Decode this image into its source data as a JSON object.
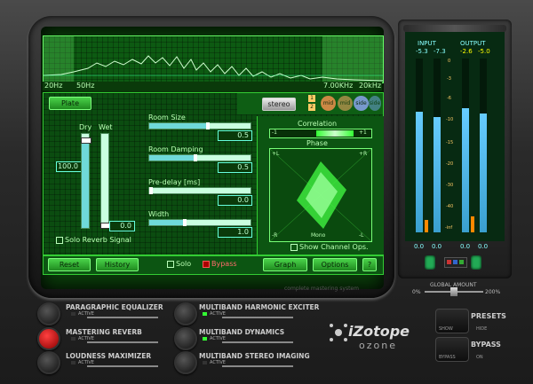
{
  "eq": {
    "f20": "20Hz",
    "f50": "50Hz",
    "f7k": "7.00KHz",
    "f20k": "20kHz"
  },
  "reverb": {
    "preset_btn": "Plate",
    "stereo_btn": "stereo",
    "band_btns": [
      "1",
      "2",
      "3",
      "4"
    ],
    "band_circles": [
      "mid",
      "mid",
      "side",
      "side"
    ],
    "dry_label": "Dry",
    "wet_label": "Wet",
    "dry_value": "100.0",
    "wet_value": "0.0",
    "solo_reverb": "Solo Reverb Signal",
    "params": [
      {
        "label": "Room Size",
        "value": "0.5"
      },
      {
        "label": "Room Damping",
        "value": "0.5"
      },
      {
        "label": "Pre-delay [ms]",
        "value": "0.0"
      },
      {
        "label": "Width",
        "value": "1.0"
      }
    ],
    "correlation": "Correlation",
    "corr_minus": "-1",
    "corr_plus": "+1",
    "phase": "Phase",
    "phase_pl": "+L",
    "phase_pr": "+R",
    "phase_ml": "-R",
    "phase_mono": "Mono",
    "phase_mr": "-L",
    "show_channel_ops": "Show Channel Ops."
  },
  "bottom_bar": {
    "reset": "Reset",
    "history": "History",
    "solo": "Solo",
    "bypass": "Bypass",
    "graph": "Graph",
    "options": "Options",
    "help": "?"
  },
  "caption": "complete mastering system",
  "meter": {
    "input": "INPUT",
    "output": "OUTPUT",
    "in_l": "-5.3",
    "in_r": "-7.3",
    "out_l": "-2.6",
    "out_r": "-5.0",
    "scale": [
      "0",
      "-3",
      "-6",
      "-10",
      "-15",
      "-20",
      "-30",
      "-40",
      "-inf"
    ],
    "bottom_vals": [
      "0.0",
      "0.0",
      "0.0",
      "0.0"
    ],
    "global_amount": "GLOBAL AMOUNT",
    "ga_min": "0%",
    "ga_max": "200%"
  },
  "modules": [
    {
      "name": "PARAGRAPHIC EQUALIZER",
      "active": "ACTIVE"
    },
    {
      "name": "MASTERING REVERB",
      "active": "ACTIVE"
    },
    {
      "name": "LOUDNESS MAXIMIZER",
      "active": "ACTIVE"
    },
    {
      "name": "MULTIBAND HARMONIC EXCITER",
      "active": "ACTIVE"
    },
    {
      "name": "MULTIBAND DYNAMICS",
      "active": "ACTIVE"
    },
    {
      "name": "MULTIBAND STEREO IMAGING",
      "active": "ACTIVE"
    }
  ],
  "logo": {
    "brand": "iZotope",
    "product": "ozone"
  },
  "presets": {
    "label": "PRESETS",
    "hide": "HIDE",
    "show": "SHOW"
  },
  "bypass": {
    "label": "BYPASS",
    "on": "ON",
    "bypass": "BYPASS"
  },
  "colors": {
    "screen": "#0b4c10",
    "accent": "#4ad34a",
    "meter": "#6cf",
    "peak": "#ff0"
  }
}
